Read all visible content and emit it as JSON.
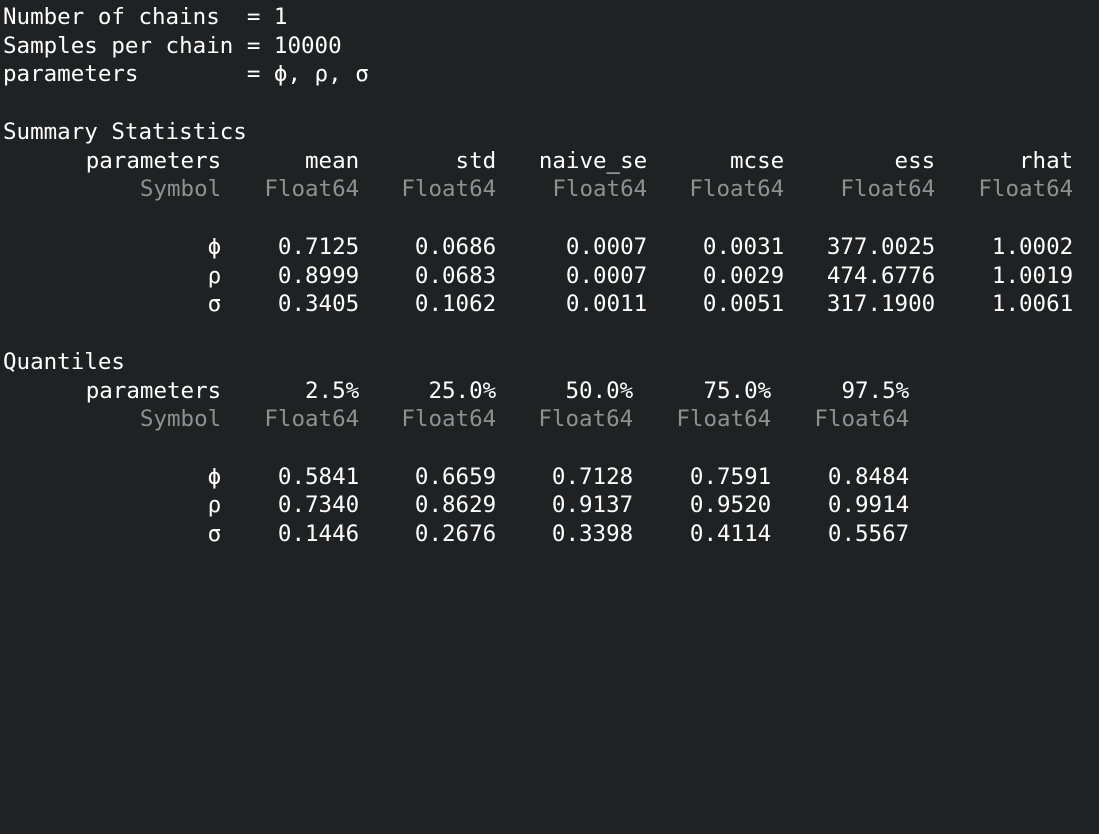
{
  "header": {
    "chains_line": "Number of chains  = 1",
    "samples_line": "Samples per chain = 10000",
    "params_line": "parameters        = ϕ, ρ, σ"
  },
  "summary": {
    "title": "Summary Statistics",
    "columns": [
      "parameters",
      "mean",
      "std",
      "naive_se",
      "mcse",
      "ess",
      "rhat"
    ],
    "types": [
      "Symbol",
      "Float64",
      "Float64",
      "Float64",
      "Float64",
      "Float64",
      "Float64"
    ],
    "rows": [
      [
        "ϕ",
        "0.7125",
        "0.0686",
        "0.0007",
        "0.0031",
        "377.0025",
        "1.0002"
      ],
      [
        "ρ",
        "0.8999",
        "0.0683",
        "0.0007",
        "0.0029",
        "474.6776",
        "1.0019"
      ],
      [
        "σ",
        "0.3405",
        "0.1062",
        "0.0011",
        "0.0051",
        "317.1900",
        "1.0061"
      ]
    ]
  },
  "quantiles": {
    "title": "Quantiles",
    "columns": [
      "parameters",
      "2.5%",
      "25.0%",
      "50.0%",
      "75.0%",
      "97.5%"
    ],
    "types": [
      "Symbol",
      "Float64",
      "Float64",
      "Float64",
      "Float64",
      "Float64"
    ],
    "rows": [
      [
        "ϕ",
        "0.5841",
        "0.6659",
        "0.7128",
        "0.7591",
        "0.8484"
      ],
      [
        "ρ",
        "0.7340",
        "0.8629",
        "0.9137",
        "0.9520",
        "0.9914"
      ],
      [
        "σ",
        "0.1446",
        "0.2676",
        "0.3398",
        "0.4114",
        "0.5567"
      ]
    ]
  },
  "colors": {
    "background": "#1f2123",
    "text": "#ffffff",
    "type_text": "#8a948f"
  }
}
